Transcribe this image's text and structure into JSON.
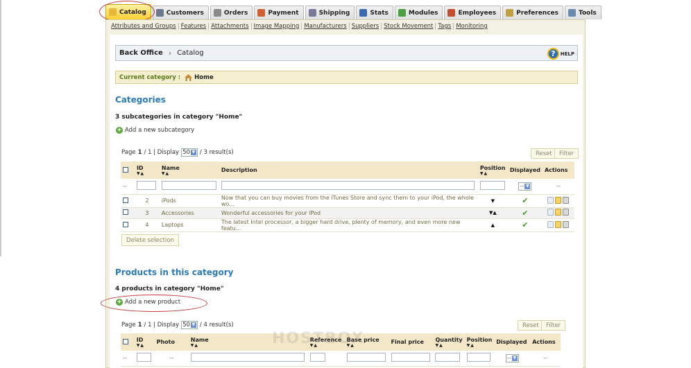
{
  "tabs": [
    {
      "label": "Catalog",
      "icon": "folder-icon",
      "color": "#e8b63a"
    },
    {
      "label": "Customers",
      "icon": "customers-icon",
      "color": "#6a7a8a"
    },
    {
      "label": "Orders",
      "icon": "cart-icon",
      "color": "#8a8a8a"
    },
    {
      "label": "Payment",
      "icon": "payment-icon",
      "color": "#d06030"
    },
    {
      "label": "Shipping",
      "icon": "truck-icon",
      "color": "#7a7a9a"
    },
    {
      "label": "Stats",
      "icon": "chart-icon",
      "color": "#3a6ab0"
    },
    {
      "label": "Modules",
      "icon": "puzzle-icon",
      "color": "#4aa040"
    },
    {
      "label": "Employees",
      "icon": "employee-icon",
      "color": "#c05030"
    },
    {
      "label": "Preferences",
      "icon": "preferences-icon",
      "color": "#c0a040"
    },
    {
      "label": "Tools",
      "icon": "tools-icon",
      "color": "#6a8ab0"
    }
  ],
  "sublinks": [
    "Attributes and Groups",
    "Features",
    "Attachments",
    "Image Mapping",
    "Manufacturers",
    "Suppliers",
    "Stock Movement",
    "Tags",
    "Monitoring"
  ],
  "breadcrumb": {
    "root": "Back Office",
    "current": "Catalog",
    "help": "HELP"
  },
  "current_category": {
    "label": "Current category :",
    "value": "Home"
  },
  "categories": {
    "title": "Categories",
    "subtitle": "3 subcategories in category \"Home\"",
    "add_label": "Add a new subcategory",
    "pager": {
      "page_label": "Page",
      "page": "1",
      "of": "/ 1 | Display",
      "display": "50",
      "results": "/ 3 result(s)"
    },
    "reset": "Reset",
    "filter": "Filter",
    "headers": {
      "id": "ID",
      "name": "Name",
      "description": "Description",
      "position": "Position",
      "displayed": "Displayed",
      "actions": "Actions"
    },
    "filter_row": {
      "dash": "--",
      "displayed": "--",
      "actions": "--"
    },
    "rows": [
      {
        "id": "2",
        "name": "iPods",
        "description": "Now that you can buy movies from the iTunes Store and sync them to your iPod, the whole wo...",
        "position": "▼"
      },
      {
        "id": "3",
        "name": "Accessories",
        "description": "Wonderful accessories for your iPod",
        "position": "▼▲"
      },
      {
        "id": "4",
        "name": "Laptops",
        "description": "The latest Intel processor, a bigger hard drive, plenty of memory, and even more new featu...",
        "position": "▲"
      }
    ],
    "delete_selection": "Delete selection"
  },
  "products": {
    "title": "Products in this category",
    "subtitle": "4 products in category \"Home\"",
    "add_label": "Add a new product",
    "pager": {
      "page_label": "Page",
      "page": "1",
      "of": "/ 1 | Display",
      "display": "50",
      "results": "/ 4 result(s)"
    },
    "reset": "Reset",
    "filter": "Filter",
    "headers": {
      "id": "ID",
      "photo": "Photo",
      "name": "Name",
      "reference": "Reference",
      "base_price": "Base price",
      "final_price": "Final price",
      "quantity": "Quantity",
      "position": "Position",
      "displayed": "Displayed",
      "actions": "Actions"
    },
    "filter_row": {
      "dash": "--",
      "photo": "--",
      "displayed": "--",
      "actions": "--"
    }
  },
  "watermark": "HOSTBOX"
}
